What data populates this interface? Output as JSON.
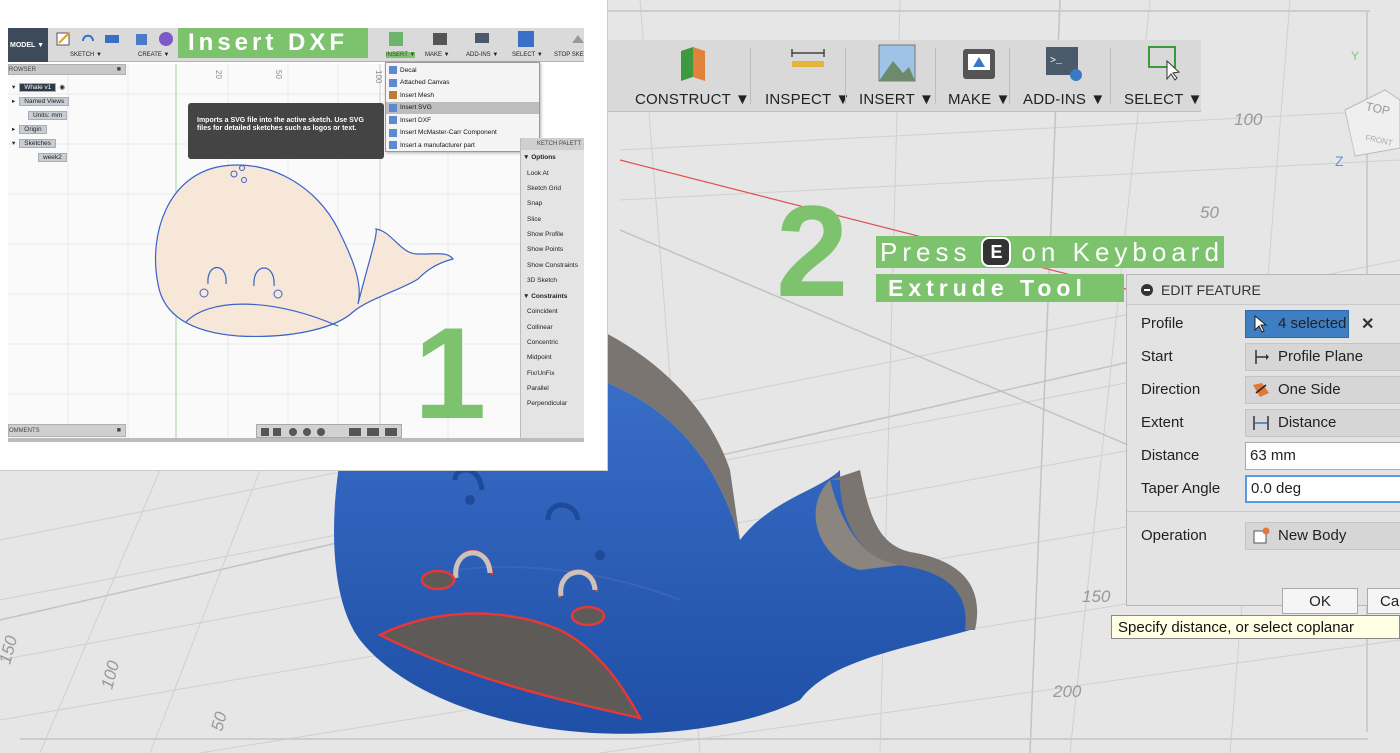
{
  "main_view": {
    "toolbar": [
      {
        "label": "CONSTRUCT ▼",
        "icon": "construct-icon"
      },
      {
        "label": "INSPECT ▼",
        "icon": "inspect-icon"
      },
      {
        "label": "INSERT ▼",
        "icon": "insert-icon"
      },
      {
        "label": "MAKE ▼",
        "icon": "make-icon"
      },
      {
        "label": "ADD-INS ▼",
        "icon": "add-ins-icon"
      },
      {
        "label": "SELECT ▼",
        "icon": "select-icon"
      }
    ],
    "viewcube": {
      "top": "TOP",
      "front": "FRONT",
      "axis_y": "Y",
      "axis_z": "Z"
    },
    "grid_labels": [
      "100",
      "50",
      "150",
      "200",
      "150",
      "100",
      "50"
    ],
    "step2": {
      "number": "2",
      "press_before": "Press",
      "key": "E",
      "press_after": "on Keyboard",
      "tool": "Extrude Tool"
    },
    "edit_feature": {
      "title": "EDIT FEATURE",
      "rows": {
        "profile": {
          "label": "Profile",
          "value": "4 selected"
        },
        "start": {
          "label": "Start",
          "value": "Profile Plane"
        },
        "direction": {
          "label": "Direction",
          "value": "One Side"
        },
        "extent": {
          "label": "Extent",
          "value": "Distance"
        },
        "distance": {
          "label": "Distance",
          "value": "63 mm"
        },
        "taper": {
          "label": "Taper Angle",
          "value": "0.0 deg"
        },
        "operation": {
          "label": "Operation",
          "value": "New Body"
        }
      },
      "clear_symbol": "✕",
      "ok": "OK",
      "cancel": "Ca"
    },
    "tooltip": "Specify distance, or select coplanar"
  },
  "inset": {
    "model_label": "MODEL ▼",
    "header_label": "Insert DXF",
    "toolbar_labels": [
      "SKETCH ▼",
      "CREATE ▼",
      "INSERT ▼",
      "MAKE ▼",
      "ADD-INS ▼",
      "SELECT ▼",
      "STOP SKE"
    ],
    "ruler_labels": [
      "20",
      "50",
      "100"
    ],
    "browser": {
      "header": "ROWSER",
      "items": [
        "Whale v1",
        "Named Views",
        "Units: mm",
        "Origin",
        "Sketches",
        "week2"
      ]
    },
    "tooltip": "Imports a SVG file into the active sketch. Use SVG files for detailed sketches such as logos or text.",
    "dropdown": [
      "Decal",
      "Attached Canvas",
      "Insert Mesh",
      "Insert SVG",
      "Insert DXF",
      "Insert McMaster-Carr Component",
      "Insert a manufacturer part"
    ],
    "palette": {
      "header": "KETCH PALETT",
      "options_title": "▼ Options",
      "options": [
        "Look At",
        "Sketch Grid",
        "Snap",
        "Slice",
        "Show Profile",
        "Show Points",
        "Show Constraints",
        "3D Sketch"
      ],
      "constraints_title": "▼ Constraints",
      "constraints": [
        "Coincident",
        "Collinear",
        "Concentric",
        "Midpoint",
        "Fix/UnFix",
        "Parallel",
        "Perpendicular"
      ]
    },
    "comments": "OMMENTS",
    "step_number": "1"
  }
}
